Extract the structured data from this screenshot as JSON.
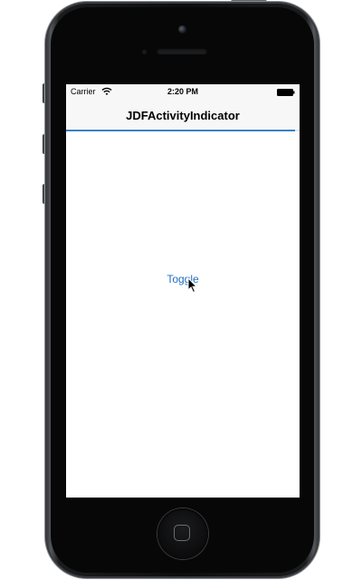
{
  "status_bar": {
    "carrier": "Carrier",
    "time": "2:20 PM",
    "wifi_icon": "wifi-icon",
    "battery_icon": "battery-icon"
  },
  "nav_bar": {
    "title": "JDFActivityIndicator"
  },
  "activity_indicator": {
    "progress": 0.98,
    "color": "#3b82c4"
  },
  "main": {
    "toggle_label": "Toggle"
  },
  "colors": {
    "accent": "#1e6fc4",
    "bar_background": "#f7f7f7"
  }
}
